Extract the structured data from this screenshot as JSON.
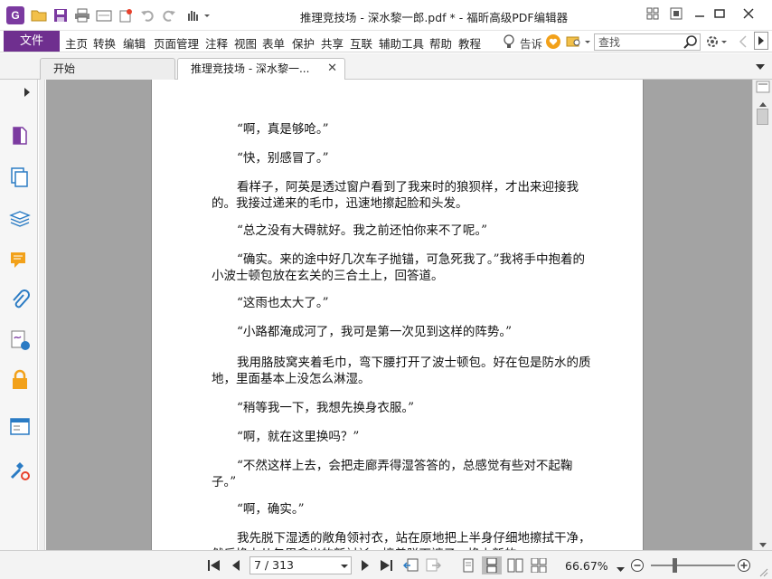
{
  "window": {
    "title": "推理竞技场 - 深水黎一郎.pdf * - 福昕高级PDF编辑器",
    "app_logo_letter": "G"
  },
  "menubar": {
    "file": "文件",
    "items": [
      "主页",
      "转换",
      "编辑",
      "页面管理",
      "注释",
      "视图",
      "表单",
      "保护",
      "共享",
      "互联",
      "辅助工具",
      "帮助",
      "教程"
    ],
    "tell_me": "告诉",
    "search_placeholder": "查找"
  },
  "tabs": [
    {
      "label": "开始"
    },
    {
      "label": "推理竞技场 - 深水黎一...",
      "close": "✕"
    }
  ],
  "document": {
    "paragraphs": [
      "“啊，真是够呛。”",
      "“快，别感冒了。”",
      "看样子，阿英是透过窗户看到了我来时的狼狈样，才出来迎接我的。我接过递来的毛巾，迅速地擦起脸和头发。",
      "“总之没有大碍就好。我之前还怕你来不了呢。”",
      "“确实。来的途中好几次车子抛锚，可急死我了。”我将手中抱着的小波士顿包放在玄关的三合土上，回答道。",
      "“这雨也太大了。”",
      "“小路都淹成河了，我可是第一次见到这样的阵势。”",
      "我用胳肢窝夹着毛巾，弯下腰打开了波士顿包。好在包是防水的质地，里面基本上没怎么淋湿。",
      "“稍等我一下，我想先换身衣服。”",
      "“啊，就在这里换吗？”",
      "“不然这样上去，会把走廊弄得湿答答的，总感觉有些对不起鞠子。”",
      "“啊，确实。”",
      "我先脱下湿透的敞角领衬衣，站在原地把上半身仔细地擦拭干净，然后换上从包里拿出的新衬衫，接着脱下裤子，换上新的"
    ]
  },
  "statusbar": {
    "page_display": "7 / 313",
    "zoom": "66.67%"
  },
  "colors": {
    "accent": "#6f2f8f",
    "doc_background": "#a3a3a3"
  }
}
